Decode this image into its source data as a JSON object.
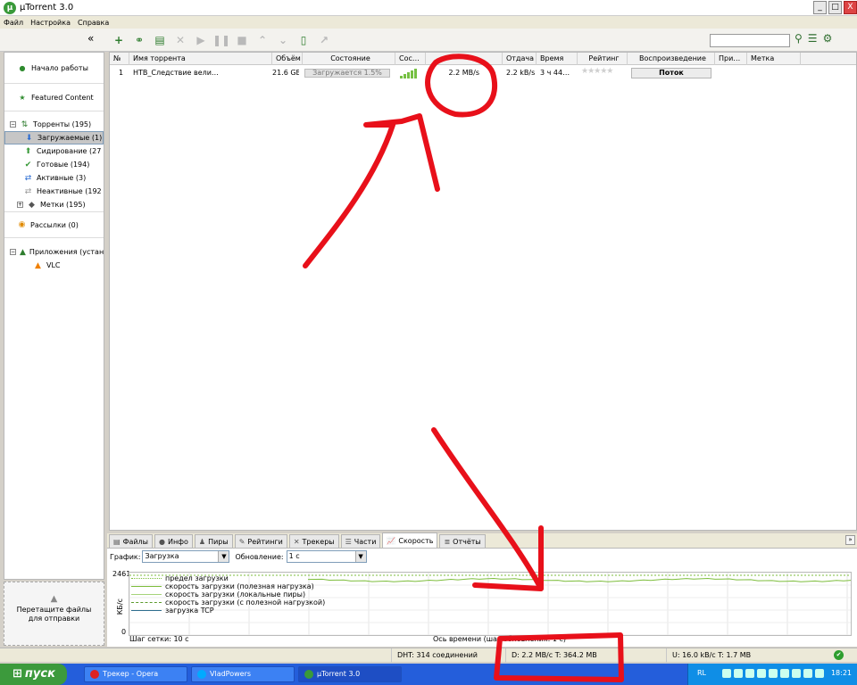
{
  "window": {
    "title": "µTorrent 3.0",
    "minimize": "_",
    "maximize": "□",
    "close": "X"
  },
  "menu": [
    "Файл",
    "Настройка",
    "Справка"
  ],
  "toolbar": {
    "collapse": "«"
  },
  "sidebar": {
    "start_label": "Начало работы",
    "featured_label": "Featured Content",
    "torrents": {
      "label": "Торренты (195)",
      "items": [
        "Загружаемые (1)",
        "Сидирование (27",
        "Готовые (194)",
        "Активные (3)",
        "Неактивные (192",
        "Метки (195)"
      ]
    },
    "rss_label": "Рассылки (0)",
    "apps_label": "Приложения (устано",
    "vlc_label": "VLC",
    "drop_text": "Перетащите файлы для отправки"
  },
  "list": {
    "columns": [
      "№",
      "Имя торрента",
      "Объём",
      "Состояние",
      "Сос…",
      "",
      "Отдача",
      "Время",
      "Рейтинг",
      "Воспроизведение",
      "При…",
      "Метка"
    ],
    "row": {
      "num": "1",
      "name": "НТВ_Следствие вели…",
      "size": "21.6 GB",
      "status": "Загружается 1.5%",
      "down": "2.2 MB/s",
      "up": "2.2 kB/s",
      "eta": "3 ч 44…",
      "stars": "★★★★★",
      "stream": "Поток"
    }
  },
  "tabs": [
    "Файлы",
    "Инфо",
    "Пиры",
    "Рейтинги",
    "Трекеры",
    "Части",
    "Скорость",
    "Отчёты"
  ],
  "tab_expand": "»",
  "graph": {
    "graph_label": "График:",
    "graph_value": "Загрузка",
    "update_label": "Обновление:",
    "update_value": "1 с",
    "ymax": "2461",
    "yunit": "КБ/с",
    "ymin": "0",
    "legend": [
      "предел загрузки",
      "скорость загрузки (полезная нагрузка)",
      "скорость загрузки (локальные пиры)",
      "скорость загрузки (с полезной нагрузкой)",
      "загрузка TCP"
    ],
    "grid_step": "Шаг сетки: 10 с",
    "time_axis": "Ось времени (шаг обновления: 1 с)",
    "line_color": "#7dbd3c"
  },
  "status": {
    "dht": "DHT: 314 соединений",
    "down": "D: 2.2 MB/с T: 364.2 MB",
    "up": "U: 16.0 kB/с T: 1.7 MB"
  },
  "taskbar": {
    "start": "пуск",
    "items": [
      "Трекер - Opera",
      "VladPowers",
      "µTorrent 3.0"
    ],
    "lang": "RL",
    "clock": "18:21"
  },
  "annotation_color": "#e8101a"
}
